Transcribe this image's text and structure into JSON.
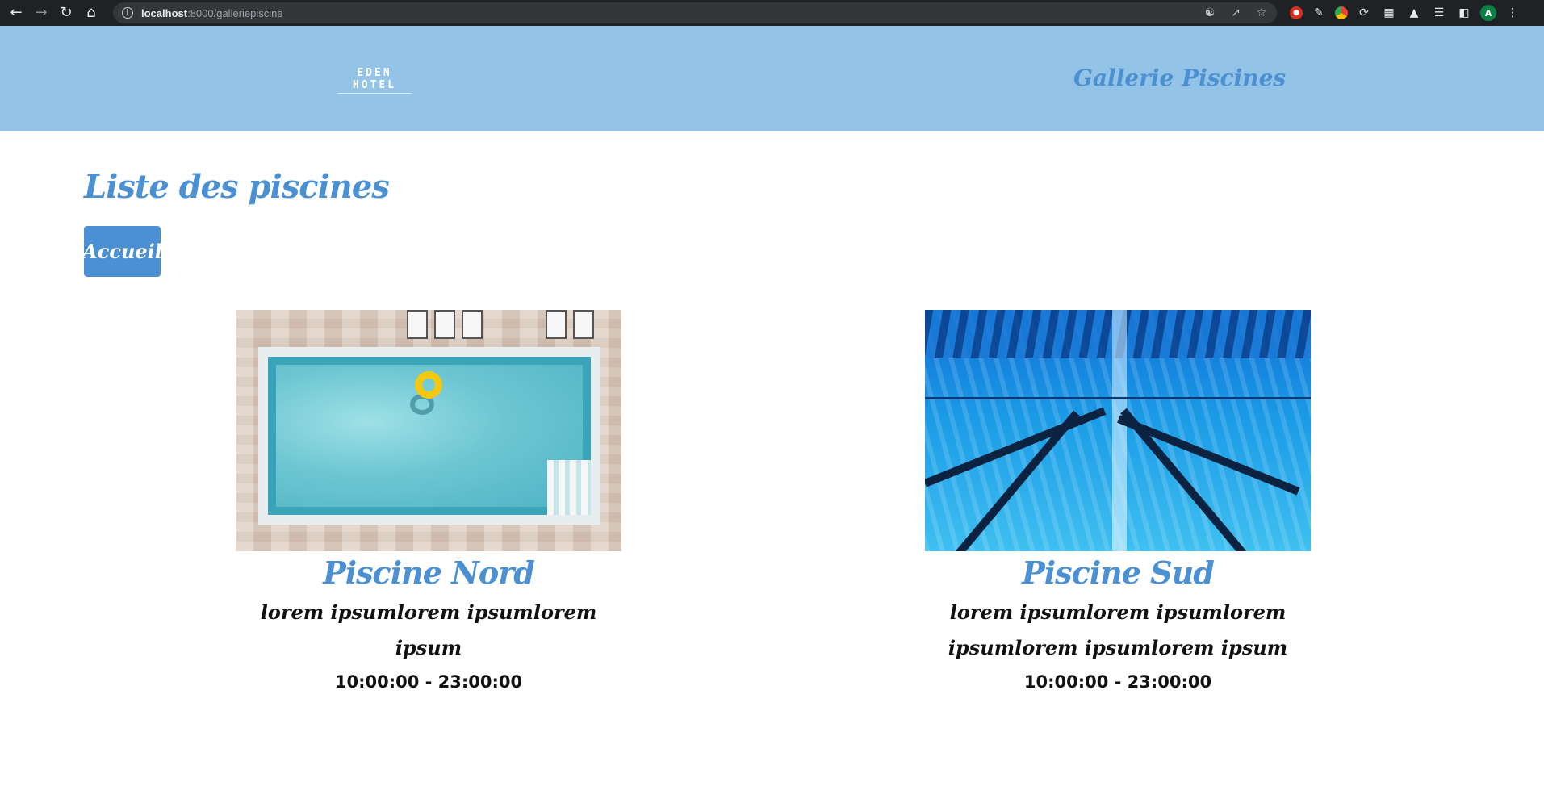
{
  "browser": {
    "url_host": "localhost",
    "url_path": ":8000/galleriepiscine",
    "avatar_letter": "A"
  },
  "header": {
    "logo_text": "EDEN HOTEL",
    "title": "Gallerie Piscines"
  },
  "main": {
    "page_title": "Liste des piscines",
    "home_button_label": "Accueil"
  },
  "pools": [
    {
      "name": "Piscine Nord",
      "description": "lorem ipsumlorem ipsumlorem ipsum",
      "hours": "10:00:00 - 23:00:00"
    },
    {
      "name": "Piscine Sud",
      "description": "lorem ipsumlorem ipsumlorem ipsumlorem ipsumlorem ipsum",
      "hours": "10:00:00 - 23:00:00"
    }
  ],
  "colors": {
    "header_bg": "#94c3e8",
    "accent_blue": "#4a90d2"
  }
}
